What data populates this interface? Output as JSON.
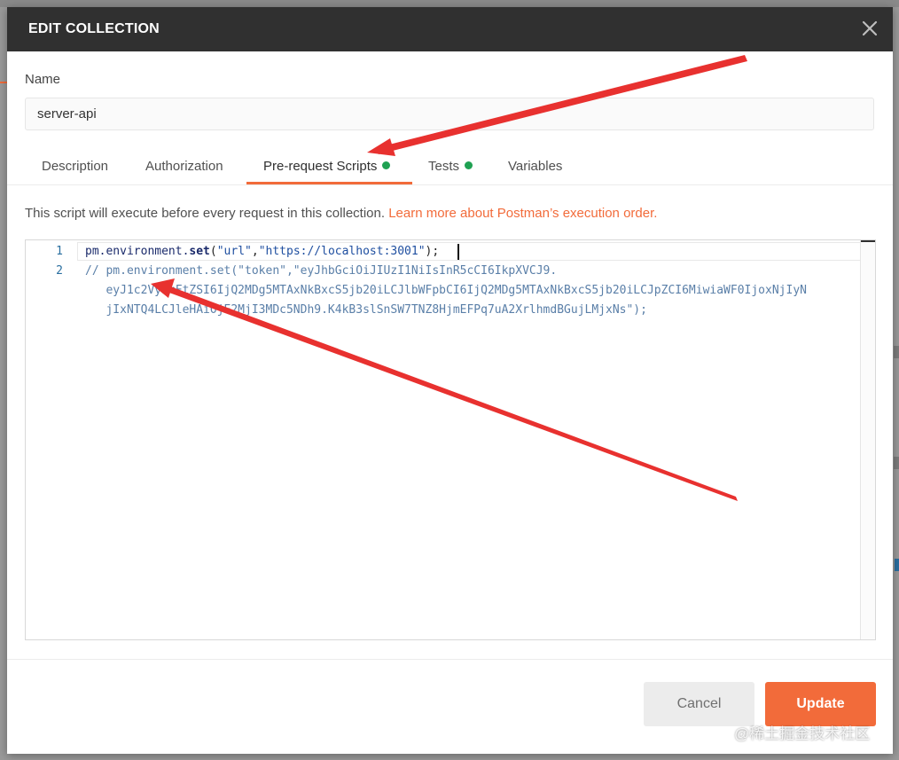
{
  "modal": {
    "title": "EDIT COLLECTION",
    "close_icon": "close-icon"
  },
  "name_field": {
    "label": "Name",
    "value": "server-api"
  },
  "tabs": [
    {
      "label": "Description",
      "active": false,
      "has_dot": false
    },
    {
      "label": "Authorization",
      "active": false,
      "has_dot": false
    },
    {
      "label": "Pre-request Scripts",
      "active": true,
      "has_dot": true
    },
    {
      "label": "Tests",
      "active": false,
      "has_dot": true
    },
    {
      "label": "Variables",
      "active": false,
      "has_dot": false
    }
  ],
  "info": {
    "text": "This script will execute before every request in this collection. ",
    "link": "Learn more about Postman’s execution order."
  },
  "editor": {
    "line_numbers": [
      "1",
      "2"
    ],
    "line1": {
      "obj": "pm.environment.",
      "method": "set",
      "open": "(",
      "arg1": "\"url\"",
      "comma": ",",
      "arg2": "\"https://localhost:3001\"",
      "close": ");"
    },
    "line2": [
      "// pm.environment.set(\"token\",\"eyJhbGciOiJIUzI1NiIsInR5cCI6IkpXVCJ9.",
      "   eyJ1c2VybmFtZSI6IjQ2MDg5MTAxNkBxcS5jb20iLCJlbWFpbCI6IjQ2MDg5MTAxNkBxcS5jb20iLCJpZCI6MiwiaWF0IjoxNjIyN",
      "   jIxNTQ4LCJleHAiOjE2MjI3MDc5NDh9.K4kB3slSnSW7TNZ8HjmEFPq7uA2XrlhmdBGujLMjxNs\");"
    ]
  },
  "buttons": {
    "cancel": "Cancel",
    "update": "Update"
  },
  "watermark": "@稀土掘金技术社区",
  "colors": {
    "accent": "#f26b3a",
    "header_bg": "#303030",
    "dot_green": "#1fa152",
    "annotation_red": "#e8312f"
  }
}
